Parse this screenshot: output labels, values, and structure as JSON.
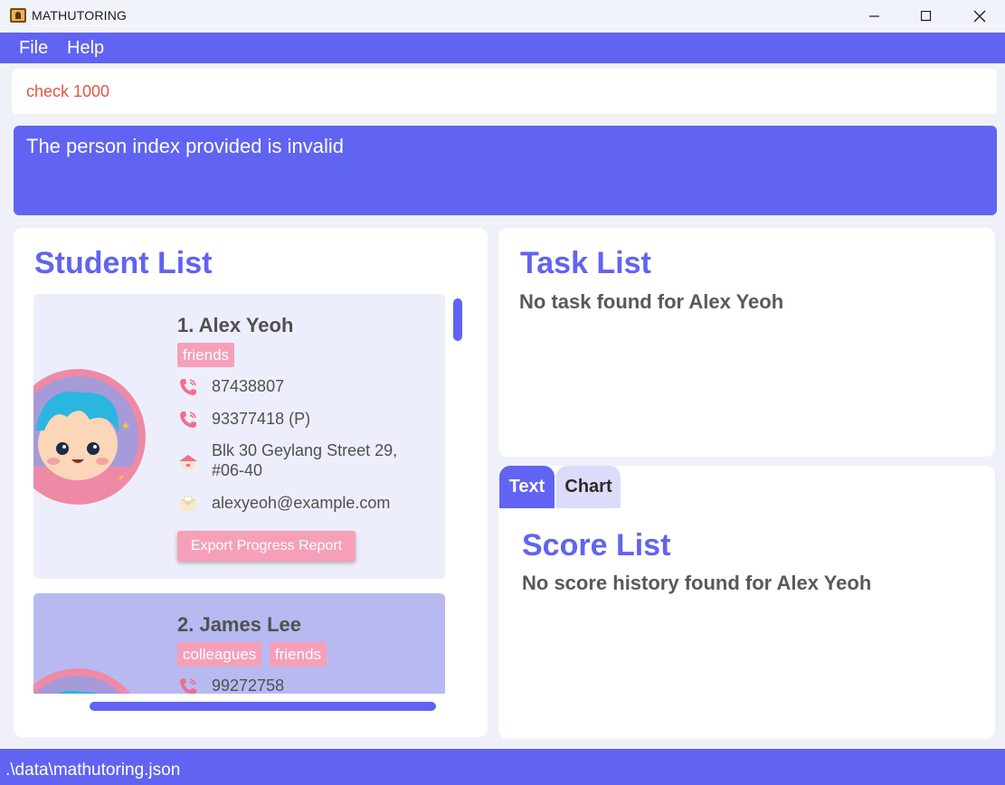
{
  "window": {
    "title": "MATHUTORING"
  },
  "menu": {
    "file": "File",
    "help": "Help"
  },
  "command": {
    "value": "check 1000"
  },
  "result": {
    "message": "The person index provided is invalid"
  },
  "student_list": {
    "title": "Student List",
    "students": [
      {
        "index_name": "1.  Alex Yeoh",
        "tags": [
          "friends"
        ],
        "phone": "87438807",
        "parent_phone": "93377418 (P)",
        "address_line1": "Blk 30 Geylang Street 29,",
        "address_line2": "#06-40",
        "email": "alexyeoh@example.com",
        "export_label": "Export Progress Report"
      },
      {
        "index_name": "2.  James Lee",
        "tags": [
          "colleagues",
          "friends"
        ],
        "phone": "99272758"
      }
    ]
  },
  "task_list": {
    "title": "Task List",
    "empty_message": "No task found for Alex Yeoh"
  },
  "score_panel": {
    "tabs": [
      "Text",
      "Chart"
    ],
    "active_tab": "Text",
    "title": "Score List",
    "empty_message": "No score history found for Alex Yeoh"
  },
  "status_bar": {
    "path": ".\\data\\mathutoring.json"
  },
  "colors": {
    "primary": "#6163f2",
    "tag": "#f5a0b8",
    "card_selected": "#edeefb",
    "card_alt": "#b8b9f0",
    "error_text": "#e0563f"
  },
  "icons": {
    "phone": "phone-icon",
    "address": "house-icon",
    "email": "envelope-icon"
  }
}
